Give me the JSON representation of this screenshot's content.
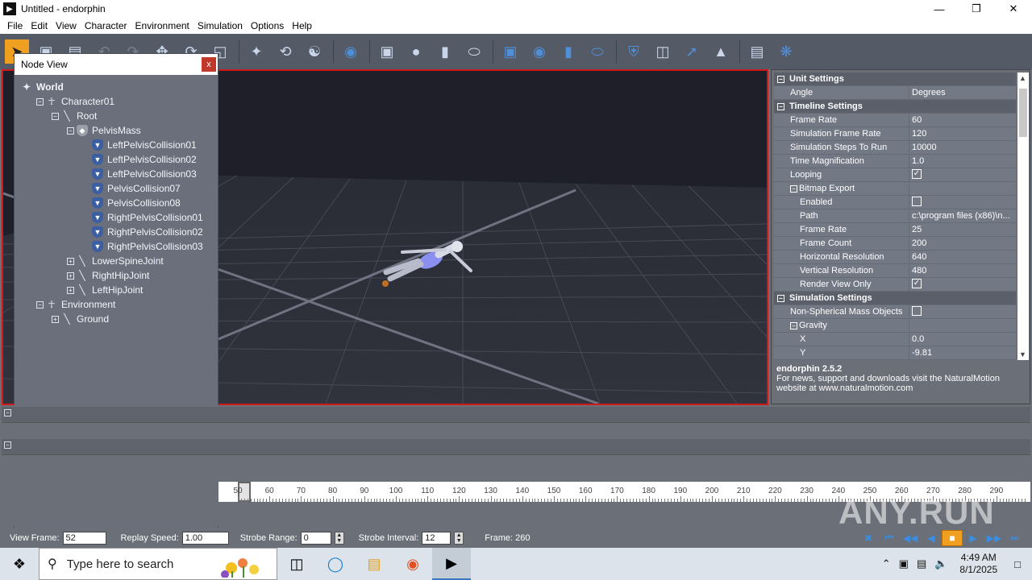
{
  "window": {
    "title": "Untitled - endorphin",
    "app_icon": "endorphin-logo",
    "minimize": "—",
    "maximize": "❐",
    "close": "✕"
  },
  "menu": [
    "File",
    "Edit",
    "View",
    "Character",
    "Environment",
    "Simulation",
    "Options",
    "Help"
  ],
  "node_view": {
    "title": "Node View",
    "close": "x",
    "tree": [
      {
        "label": "World",
        "depth": 0,
        "expander": "",
        "icon": "world-icon",
        "bold": true
      },
      {
        "label": "Character01",
        "depth": 1,
        "expander": "−",
        "icon": "character-icon"
      },
      {
        "label": "Root",
        "depth": 2,
        "expander": "−",
        "icon": "bone-icon"
      },
      {
        "label": "PelvisMass",
        "depth": 3,
        "expander": "−",
        "icon": "mass-icon"
      },
      {
        "label": "LeftPelvisCollision01",
        "depth": 4,
        "expander": "",
        "icon": "collision-icon"
      },
      {
        "label": "LeftPelvisCollision02",
        "depth": 4,
        "expander": "",
        "icon": "collision-icon"
      },
      {
        "label": "LeftPelvisCollision03",
        "depth": 4,
        "expander": "",
        "icon": "collision-icon"
      },
      {
        "label": "PelvisCollision07",
        "depth": 4,
        "expander": "",
        "icon": "collision-icon"
      },
      {
        "label": "PelvisCollision08",
        "depth": 4,
        "expander": "",
        "icon": "collision-icon"
      },
      {
        "label": "RightPelvisCollision01",
        "depth": 4,
        "expander": "",
        "icon": "collision-icon"
      },
      {
        "label": "RightPelvisCollision02",
        "depth": 4,
        "expander": "",
        "icon": "collision-icon"
      },
      {
        "label": "RightPelvisCollision03",
        "depth": 4,
        "expander": "",
        "icon": "collision-icon"
      },
      {
        "label": "LowerSpineJoint",
        "depth": 3,
        "expander": "+",
        "icon": "bone-icon"
      },
      {
        "label": "RightHipJoint",
        "depth": 3,
        "expander": "+",
        "icon": "bone-icon"
      },
      {
        "label": "LeftHipJoint",
        "depth": 3,
        "expander": "+",
        "icon": "bone-icon"
      },
      {
        "label": "Environment",
        "depth": 1,
        "expander": "−",
        "icon": "character-icon"
      },
      {
        "label": "Ground",
        "depth": 2,
        "expander": "+",
        "icon": "bone-icon"
      }
    ]
  },
  "properties": [
    {
      "kind": "cat",
      "name": "Unit Settings"
    },
    {
      "kind": "prop",
      "name": "Angle",
      "value": "Degrees"
    },
    {
      "kind": "cat",
      "name": "Timeline Settings"
    },
    {
      "kind": "prop",
      "name": "Frame Rate",
      "value": "60"
    },
    {
      "kind": "prop",
      "name": "Simulation Frame Rate",
      "value": "120"
    },
    {
      "kind": "prop",
      "name": "Simulation Steps To Run",
      "value": "10000"
    },
    {
      "kind": "prop",
      "name": "Time Magnification",
      "value": "1.0"
    },
    {
      "kind": "check",
      "name": "Looping",
      "value": true
    },
    {
      "kind": "subcat",
      "name": "Bitmap Export"
    },
    {
      "kind": "subcheck",
      "name": "Enabled",
      "value": false
    },
    {
      "kind": "sub",
      "name": "Path",
      "value": "c:\\program files (x86)\\n..."
    },
    {
      "kind": "sub",
      "name": "Frame Rate",
      "value": "25"
    },
    {
      "kind": "sub",
      "name": "Frame Count",
      "value": "200"
    },
    {
      "kind": "sub",
      "name": "Horizontal Resolution",
      "value": "640"
    },
    {
      "kind": "sub",
      "name": "Vertical Resolution",
      "value": "480"
    },
    {
      "kind": "subcheck",
      "name": "Render View Only",
      "value": true
    },
    {
      "kind": "cat",
      "name": "Simulation Settings"
    },
    {
      "kind": "check",
      "name": "Non-Spherical Mass Objects",
      "value": false
    },
    {
      "kind": "subcat",
      "name": "Gravity"
    },
    {
      "kind": "sub",
      "name": "X",
      "value": "0.0"
    },
    {
      "kind": "sub",
      "name": "Y",
      "value": "-9.81"
    }
  ],
  "info": {
    "title": "endorphin 2.5.2",
    "text": "For news, support and downloads visit the NaturalMotion website at www.naturalmotion.com"
  },
  "timeline": {
    "ticks": [
      "50",
      "60",
      "70",
      "80",
      "90",
      "100",
      "110",
      "120",
      "130",
      "140",
      "150",
      "160",
      "170",
      "180",
      "190",
      "200",
      "210",
      "220",
      "230",
      "240",
      "250",
      "260",
      "270",
      "280",
      "290"
    ],
    "row_toggles": [
      "−",
      "−"
    ]
  },
  "statusbar": {
    "view_frame_label": "View Frame:",
    "view_frame_value": "52",
    "replay_speed_label": "Replay Speed:",
    "replay_speed_value": "1.00",
    "strobe_range_label": "Strobe Range:",
    "strobe_range_value": "0",
    "strobe_interval_label": "Strobe Interval:",
    "strobe_interval_value": "12",
    "frame_label": "Frame: 260"
  },
  "watermark": "ANY.RUN",
  "taskbar": {
    "search_placeholder": "Type here to search",
    "time": "4:49 AM",
    "date": "8/1/2025"
  }
}
